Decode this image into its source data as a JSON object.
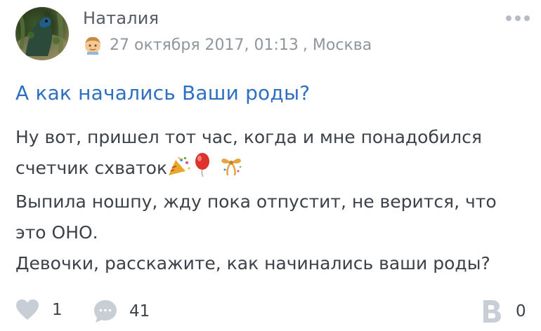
{
  "post": {
    "author": "Наталия",
    "date": "27 октября 2017, 01:13",
    "location": ", Москва",
    "title": "А как начались Ваши роды?",
    "body_line1": "Ну вот, пришел тот час, когда и мне понадобился",
    "body_line2": "счетчик схваток",
    "body_line3": "Выпила ношпу, жду пока отпустит, не верится, что",
    "body_line4": "это ОНО.",
    "body_line5": "Девочки, расскажите, как начинались ваши роды?"
  },
  "icons": {
    "more": "more-dots-icon",
    "user": "user-face-icon",
    "emoji": [
      "party-popper-emoji",
      "balloon-emoji",
      "ribbon-bow-emoji"
    ],
    "like": "heart-icon",
    "comment": "comment-bubble-icon",
    "brand": "b-logo-icon"
  },
  "footer": {
    "likes": "1",
    "comments": "41",
    "shares": "0"
  },
  "colors": {
    "title": "#2f6fc2",
    "text": "#3c4248",
    "muted": "#8f969c",
    "icon": "#c8ced5"
  }
}
